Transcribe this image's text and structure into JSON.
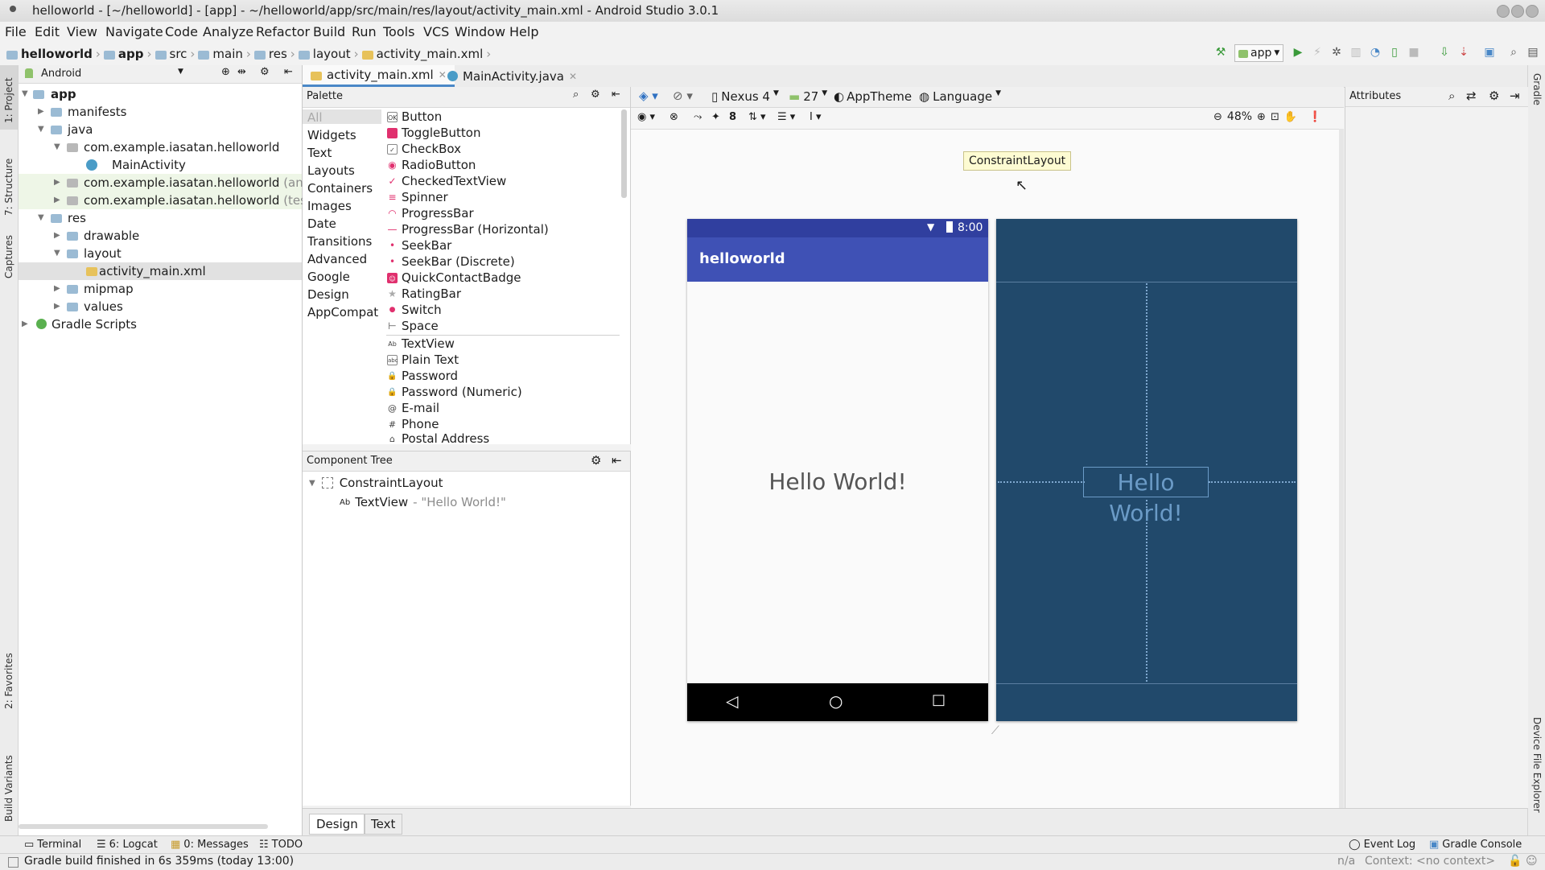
{
  "window": {
    "title": "helloworld - [~/helloworld] - [app] - ~/helloworld/app/src/main/res/layout/activity_main.xml - Android Studio 3.0.1"
  },
  "menu": [
    "File",
    "Edit",
    "View",
    "Navigate",
    "Code",
    "Analyze",
    "Refactor",
    "Build",
    "Run",
    "Tools",
    "VCS",
    "Window",
    "Help"
  ],
  "breadcrumbs": [
    "helloworld",
    "app",
    "src",
    "main",
    "res",
    "layout",
    "activity_main.xml"
  ],
  "run_config": "app",
  "side_left": {
    "project": "1: Project",
    "structure": "7: Structure",
    "captures": "Captures",
    "favorites": "2: Favorites",
    "build_variants": "Build Variants"
  },
  "side_right": {
    "gradle": "Gradle",
    "device_explorer": "Device File Explorer"
  },
  "project_panel": {
    "view_mode": "Android",
    "tree": [
      {
        "label": "app",
        "bold": true
      },
      {
        "label": "manifests"
      },
      {
        "label": "java"
      },
      {
        "label": "com.example.iasatan.helloworld"
      },
      {
        "label": "MainActivity"
      },
      {
        "label": "com.example.iasatan.helloworld",
        "suffix": "(andro"
      },
      {
        "label": "com.example.iasatan.helloworld",
        "suffix": "(test)"
      },
      {
        "label": "res"
      },
      {
        "label": "drawable"
      },
      {
        "label": "layout"
      },
      {
        "label": "activity_main.xml"
      },
      {
        "label": "mipmap"
      },
      {
        "label": "values"
      },
      {
        "label": "Gradle Scripts"
      }
    ]
  },
  "editor_tabs": [
    {
      "label": "activity_main.xml"
    },
    {
      "label": "MainActivity.java"
    }
  ],
  "palette": {
    "title": "Palette",
    "categories": [
      "All",
      "Widgets",
      "Text",
      "Layouts",
      "Containers",
      "Images",
      "Date",
      "Transitions",
      "Advanced",
      "Google",
      "Design",
      "AppCompat"
    ],
    "items": [
      {
        "label": "Button",
        "icon": "OK"
      },
      {
        "label": "ToggleButton",
        "icon": ""
      },
      {
        "label": "CheckBox",
        "icon": "✓"
      },
      {
        "label": "RadioButton",
        "icon": "◉"
      },
      {
        "label": "CheckedTextView",
        "icon": "✓"
      },
      {
        "label": "Spinner",
        "icon": "≡"
      },
      {
        "label": "ProgressBar",
        "icon": "◠"
      },
      {
        "label": "ProgressBar (Horizontal)",
        "icon": "—"
      },
      {
        "label": "SeekBar",
        "icon": "•"
      },
      {
        "label": "SeekBar (Discrete)",
        "icon": "•"
      },
      {
        "label": "QuickContactBadge",
        "icon": "☺"
      },
      {
        "label": "RatingBar",
        "icon": "★"
      },
      {
        "label": "Switch",
        "icon": "●"
      },
      {
        "label": "Space",
        "icon": "⊢"
      },
      {
        "label": "TextView",
        "icon": "Ab"
      },
      {
        "label": "Plain Text",
        "icon": "abc"
      },
      {
        "label": "Password",
        "icon": "🔒"
      },
      {
        "label": "Password (Numeric)",
        "icon": "🔒"
      },
      {
        "label": "E-mail",
        "icon": "@"
      },
      {
        "label": "Phone",
        "icon": "#"
      },
      {
        "label": "Postal Address",
        "icon": "⌂"
      }
    ]
  },
  "component_tree": {
    "title": "Component Tree",
    "root": "ConstraintLayout",
    "child_type": "TextView",
    "child_text": "- \"Hello World!\""
  },
  "canvas": {
    "device": "Nexus 4",
    "api": "27",
    "theme": "AppTheme",
    "language": "Language",
    "zoom": "48%",
    "margin": "8",
    "tooltip": "ConstraintLayout",
    "phone": {
      "time": "8:00",
      "app_title": "helloworld",
      "text": "Hello World!"
    },
    "blueprint_text": "Hello World!"
  },
  "attributes": {
    "title": "Attributes"
  },
  "design_tabs": [
    "Design",
    "Text"
  ],
  "bottom_tools": [
    {
      "label": "Terminal"
    },
    {
      "label": "6: Logcat"
    },
    {
      "label": "0: Messages"
    },
    {
      "label": "TODO"
    }
  ],
  "bottom_right_tools": [
    "Event Log",
    "Gradle Console"
  ],
  "status": {
    "message": "Gradle build finished in 6s 359ms (today 13:00)",
    "position": "n/a",
    "context": "Context: <no context>"
  },
  "colors": {
    "accent": "#3f51b5",
    "blueprint": "#21496b",
    "run_green": "#3a9a3a"
  }
}
